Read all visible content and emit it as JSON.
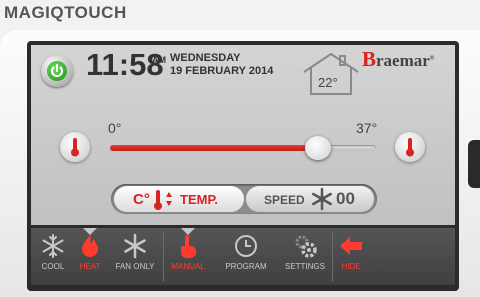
{
  "brand": "MAGIQTOUCH",
  "display": {
    "time": "11:58",
    "ampm": "AM",
    "day": "WEDNESDAY",
    "date": "19 FEBRUARY 2014",
    "room_temp": "22°",
    "logo_initial": "B",
    "logo_rest": "raemar",
    "logo_mark": "®"
  },
  "slider": {
    "min_label": "0°",
    "max_label": "37°",
    "min": 0,
    "max": 37,
    "value": 29
  },
  "mode_toggle": {
    "unit": "C°",
    "temp_label": "TEMP.",
    "speed_label": "SPEED",
    "speed_value": "00"
  },
  "nav": {
    "cool": "COOL",
    "heat": "HEAT",
    "fan_only": "FAN ONLY",
    "manual": "MANUAL",
    "program": "PROGRAM",
    "settings": "SETTINGS",
    "hide": "HIDE"
  },
  "colors": {
    "accent": "#d8231f",
    "power": "#2fa52a",
    "panel": "#c8c8c8",
    "navbar": "#4a4a4a"
  },
  "icons": {
    "power": "power-icon",
    "house": "house-icon",
    "thermometer": "thermometer-icon",
    "fan": "fan-icon",
    "snowflake": "snowflake-icon",
    "flame": "flame-icon",
    "hand": "hand-icon",
    "clock": "clock-icon",
    "gear": "gear-icon",
    "arrow": "arrow-left-icon"
  }
}
